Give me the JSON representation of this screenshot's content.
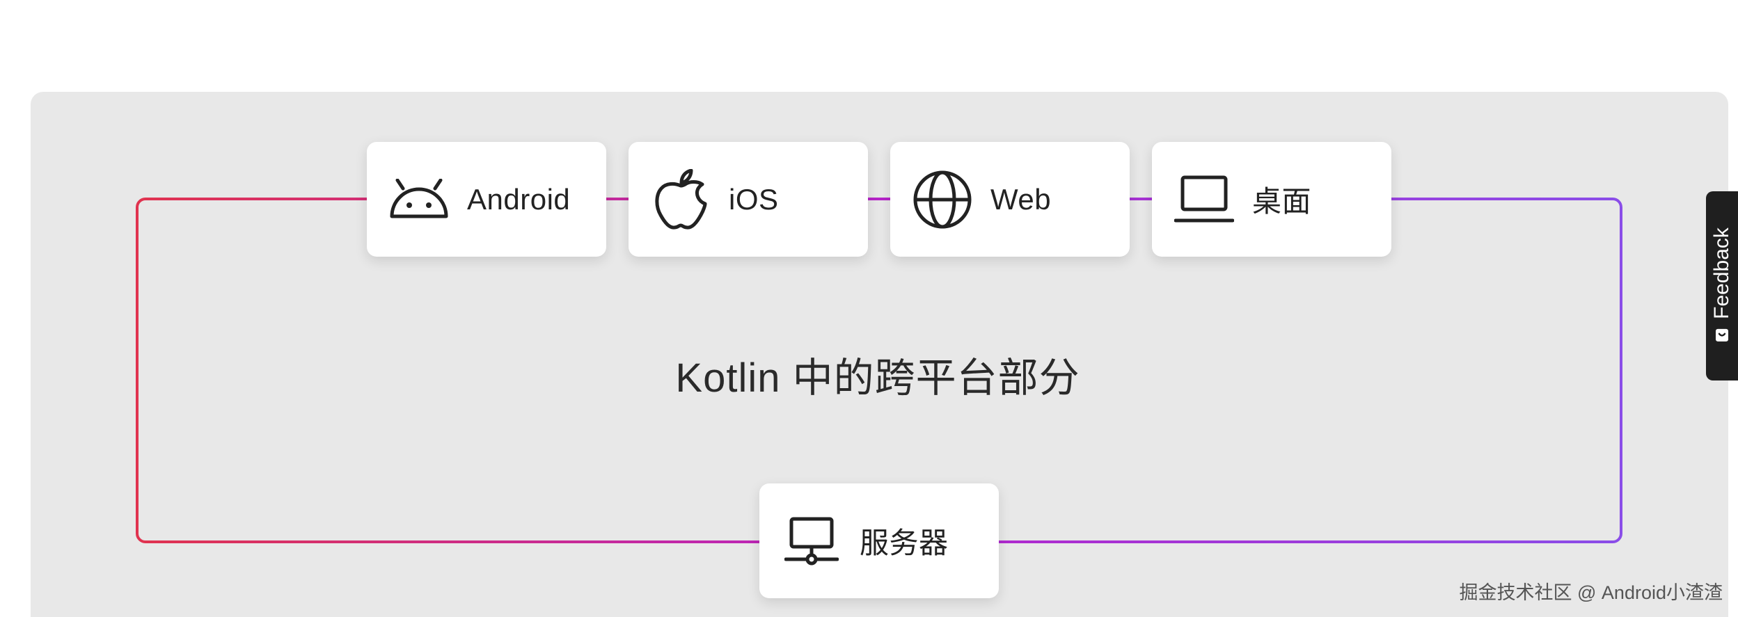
{
  "diagram": {
    "title": "Kotlin 中的跨平台部分",
    "platforms": [
      {
        "label": "Android",
        "icon": "android-icon"
      },
      {
        "label": "iOS",
        "icon": "apple-icon"
      },
      {
        "label": "Web",
        "icon": "globe-icon"
      },
      {
        "label": "桌面",
        "icon": "laptop-icon"
      }
    ],
    "server": {
      "label": "服务器",
      "icon": "server-icon"
    },
    "gradient": {
      "start": "#e0334f",
      "middle": "#b624c9",
      "end": "#8a4de8"
    }
  },
  "feedback": {
    "label": "Feedback",
    "icon": "feedback-icon"
  },
  "watermark": {
    "text": "掘金技术社区 @ Android小渣渣"
  }
}
